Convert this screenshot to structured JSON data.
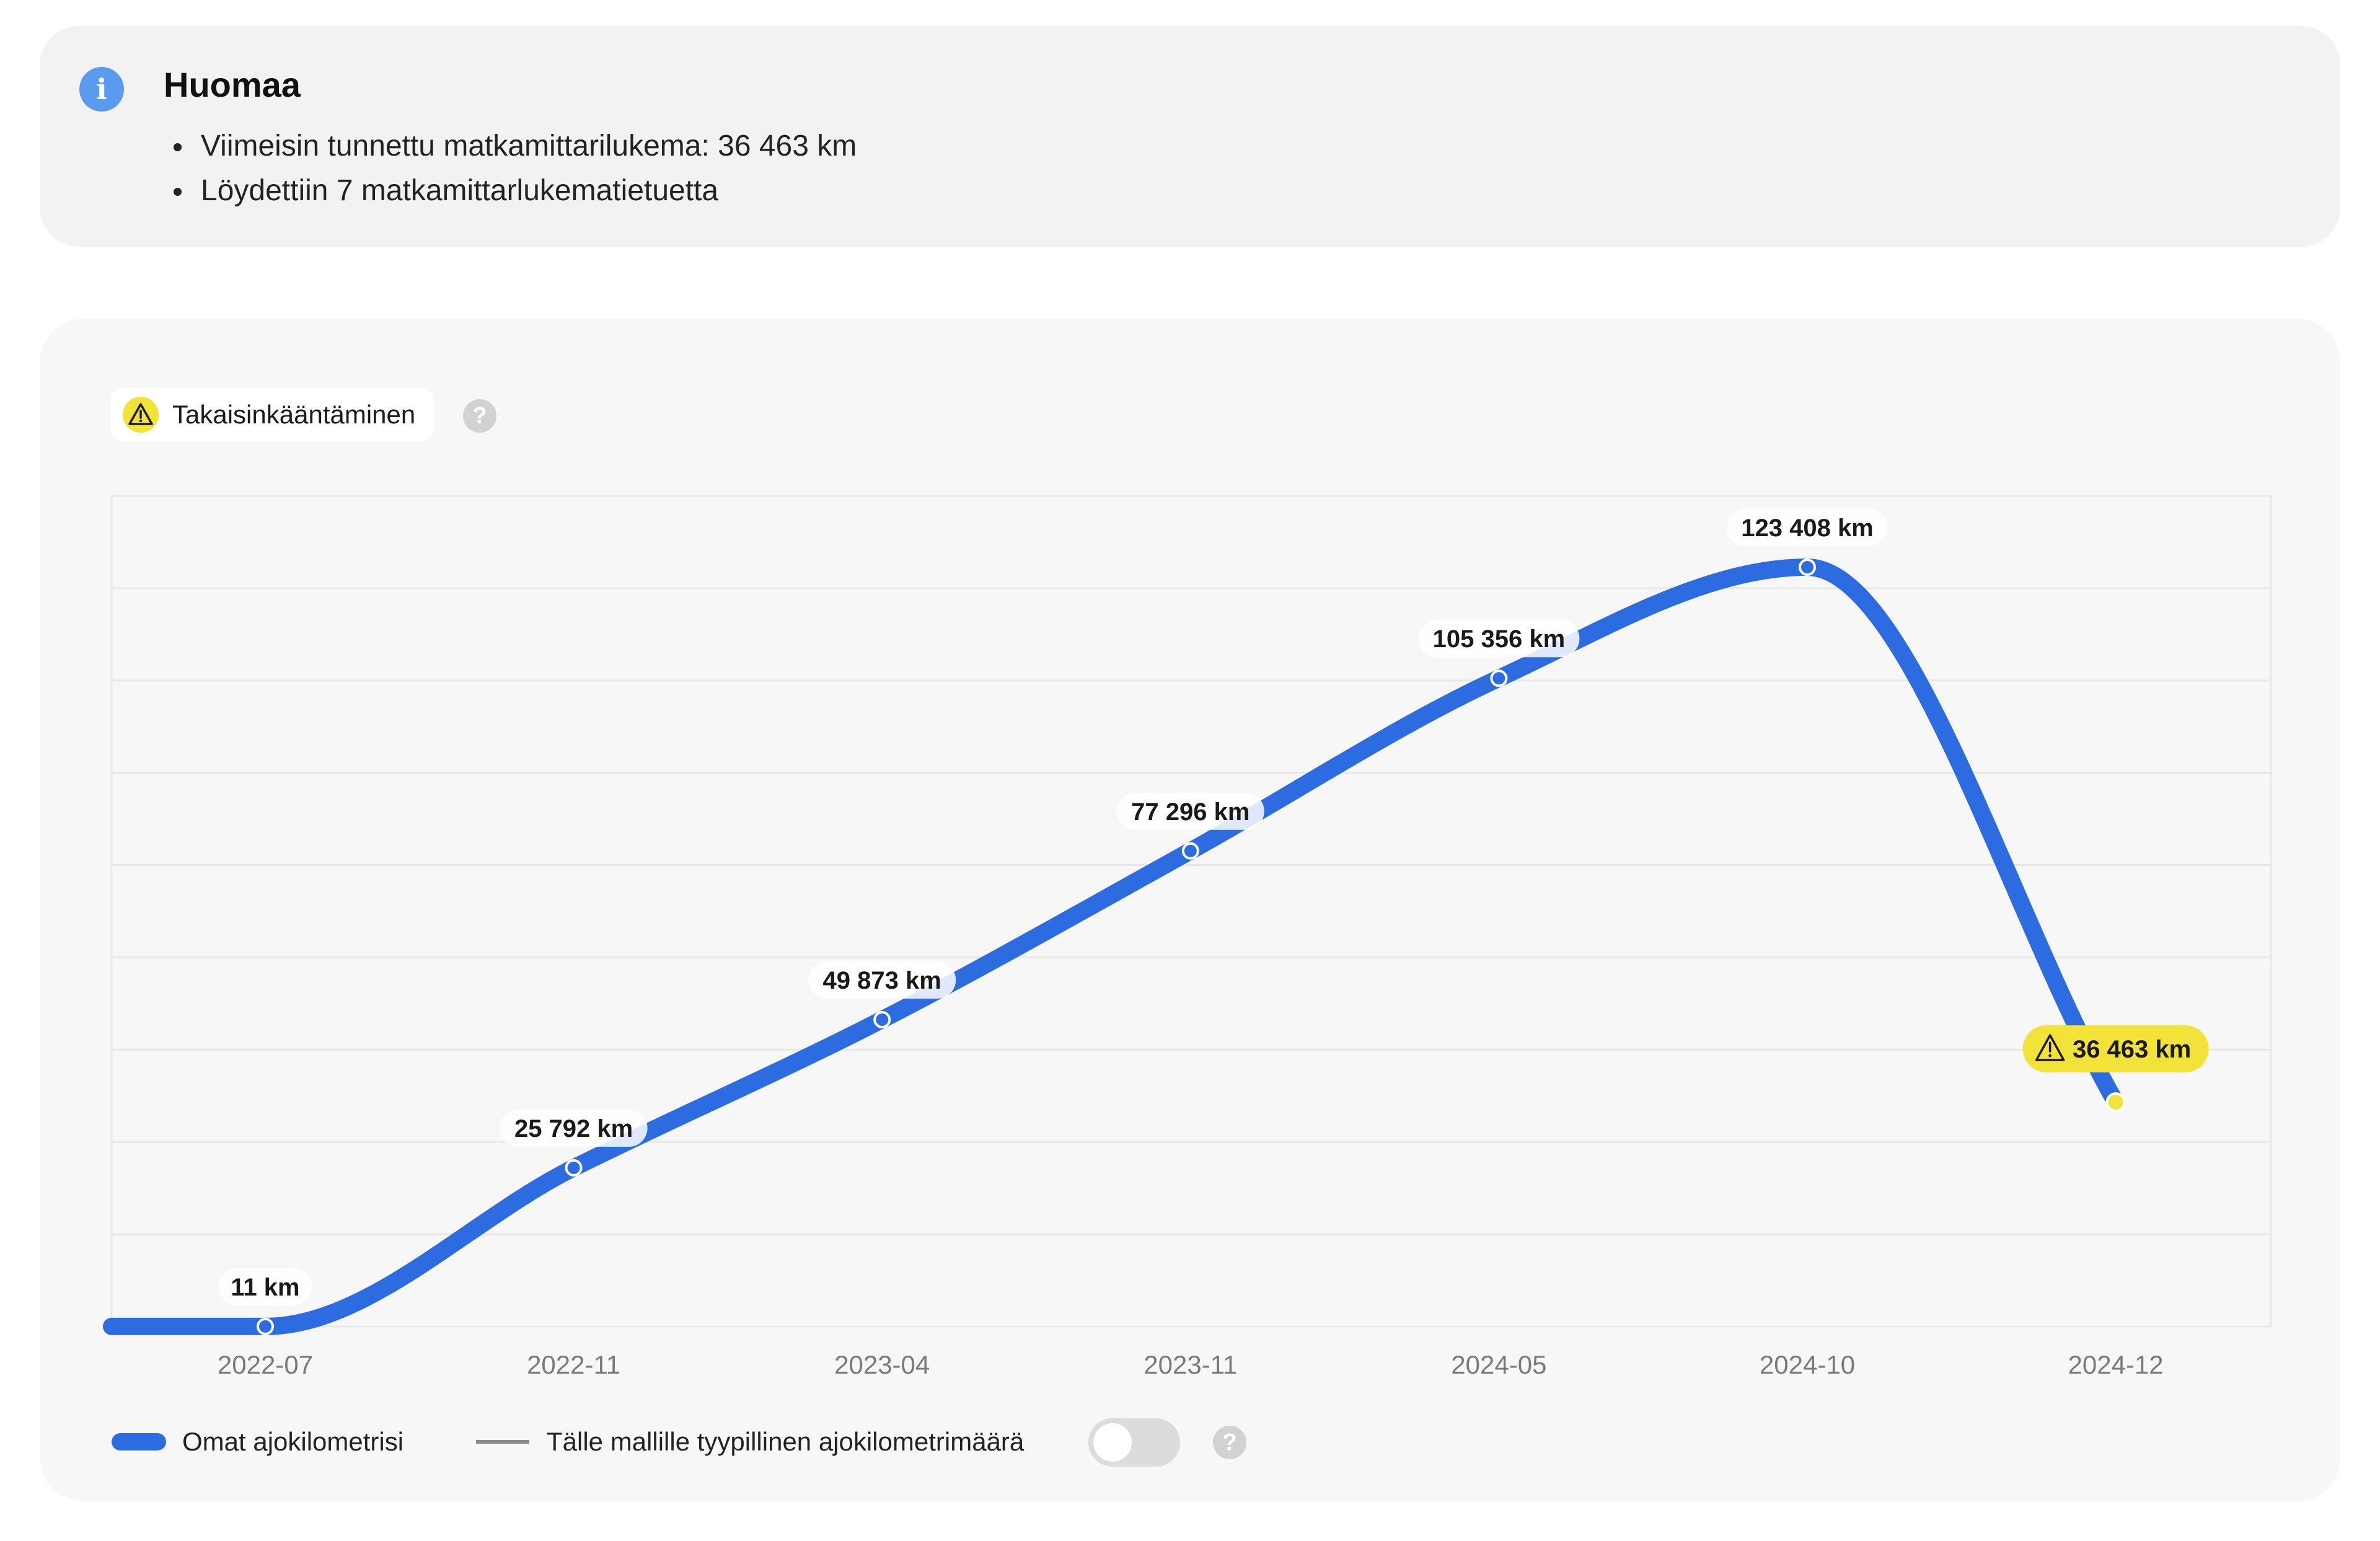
{
  "notice": {
    "title": "Huomaa",
    "items": [
      "Viimeisin tunnettu matkamittarilukema: 36 463 km",
      "Löydettiin 7 matkamittarlukematietuetta"
    ],
    "icon": "info-icon"
  },
  "chip": {
    "label": "Takaisinkääntäminen",
    "icon": "warning-icon"
  },
  "legend": {
    "mine_label": "Omat ajokilometrisi",
    "typical_label": "Tälle mallille tyypillinen ajokilometrimäärä",
    "typical_toggle_on": false
  },
  "colors": {
    "line": "#2d6be0",
    "warning": "#f2e23a",
    "card_bg": "#f7f7f7",
    "grid": "#e8e8e8"
  },
  "chart_data": {
    "type": "line",
    "x": [
      "2022-07",
      "2022-11",
      "2023-04",
      "2023-11",
      "2024-05",
      "2024-10",
      "2024-12"
    ],
    "series": [
      {
        "name": "Omat ajokilometrisi",
        "values": [
          11,
          25792,
          49873,
          77296,
          105356,
          123408,
          36463
        ],
        "labels": [
          "11 km",
          "25 792 km",
          "49 873 km",
          "77 296 km",
          "105 356 km",
          "123 408 km",
          "36 463 km"
        ]
      }
    ],
    "flagged": {
      "index": 6,
      "reason": "Takaisinkääntäminen"
    },
    "ylim": [
      0,
      135000
    ],
    "grid": true,
    "title": "",
    "xlabel": "",
    "ylabel": ""
  }
}
